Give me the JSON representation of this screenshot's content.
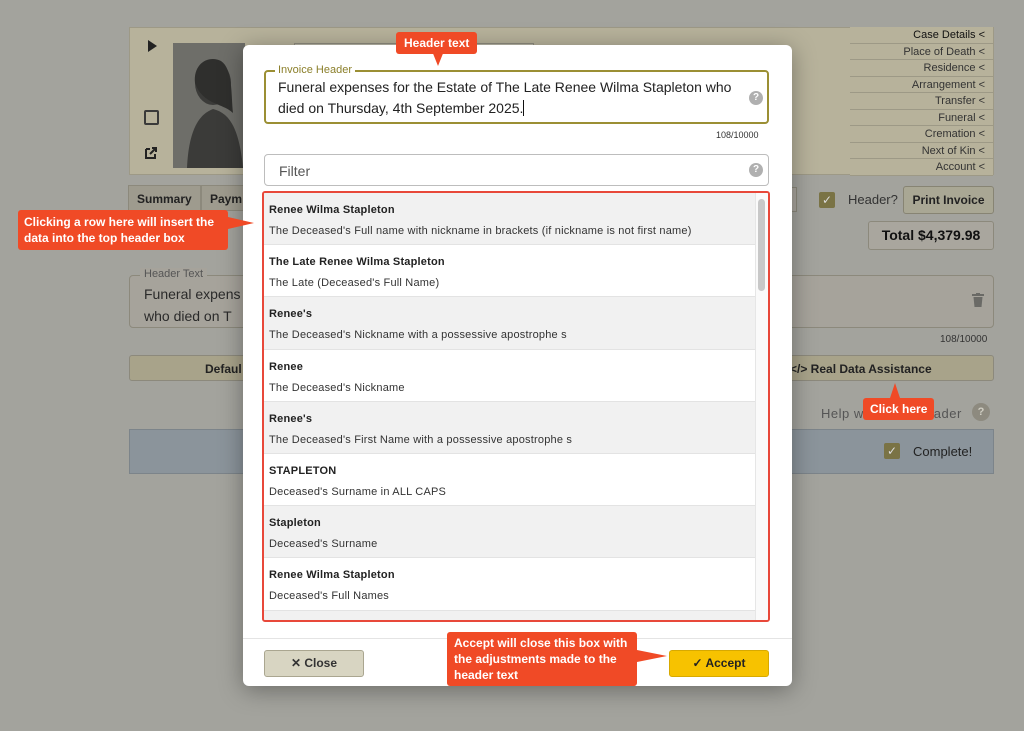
{
  "background": {
    "case_menu": [
      "Case Details <",
      "Place of Death <",
      "Residence <",
      "Arrangement <",
      "Transfer <",
      "Funeral <",
      "Cremation <",
      "Next of Kin <",
      "Account <"
    ],
    "tabs": [
      "Summary",
      "Paym"
    ],
    "header_toggle_label": "Header?",
    "print_invoice_label": "Print Invoice",
    "total": "Total $4,379.98",
    "header_text_legend": "Header Text",
    "header_text_line1": "Funeral expens",
    "header_text_line2": "who died on T",
    "header_text_count": "108/10000",
    "default_label": "Defaul",
    "real_data_label": "</> Real Data Assistance",
    "help_label": "Help w",
    "help_label_tail": "ader",
    "complete_label": "Complete!"
  },
  "modal": {
    "invoice_header_legend": "Invoice Header",
    "invoice_header_value": "Funeral expenses for the Estate of The Late Renee Wilma Stapleton who died on Thursday, 4th September 2025.",
    "char_count": "108/10000",
    "filter_placeholder": "Filter",
    "rows": [
      {
        "title": "Renee Wilma Stapleton",
        "desc": "The Deceased's Full name with nickname in brackets (if nickname is not first name)"
      },
      {
        "title": "The Late Renee Wilma Stapleton",
        "desc": "The Late (Deceased's Full Name)"
      },
      {
        "title": "Renee's",
        "desc": "The Deceased's Nickname with a possessive apostrophe s"
      },
      {
        "title": "Renee",
        "desc": "The Deceased's Nickname"
      },
      {
        "title": "Renee's",
        "desc": "The Deceased's First Name with a possessive apostrophe s"
      },
      {
        "title": "STAPLETON",
        "desc": "Deceased's Surname in ALL CAPS"
      },
      {
        "title": "Stapleton",
        "desc": "Deceased's Surname"
      },
      {
        "title": "Renee Wilma Stapleton",
        "desc": "Deceased's Full Names"
      }
    ],
    "close_label": "Close",
    "accept_label": "Accept"
  },
  "callouts": {
    "header_text": "Header text",
    "row_help": "Clicking a row here will insert the data into the top header box",
    "click_here": "Click here",
    "accept_help": "Accept will close this box with the adjustments made to the header text"
  },
  "colors": {
    "callout": "#f04a26",
    "accept": "#f7c200",
    "field_border": "#9b8f34"
  }
}
